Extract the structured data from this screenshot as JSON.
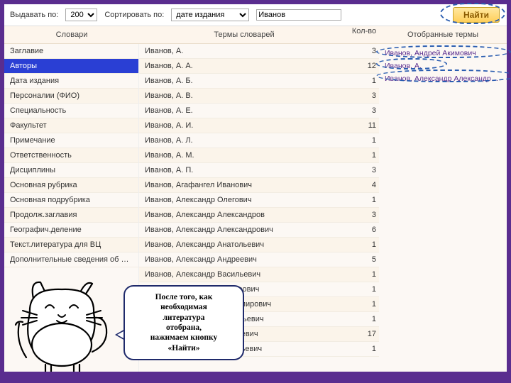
{
  "toolbar": {
    "perpage_label": "Выдавать по:",
    "perpage_value": "200",
    "sort_label": "Сортировать по:",
    "sort_value": "дате издания",
    "search_value": "Иванов",
    "find_label": "Найти"
  },
  "headers": {
    "dict": "Словари",
    "terms": "Термы словарей",
    "count": "Кол-во",
    "selected": "Отобранные термы"
  },
  "dictionaries": [
    "Заглавие",
    "Авторы",
    "Дата издания",
    "Персоналии (ФИО)",
    "Специальность",
    "Факультет",
    "Примечание",
    "Ответственность",
    "Дисциплины",
    "Основная рубрика",
    "Основная подрубрика",
    "Продолж.заглавия",
    "Географич.деление",
    "Текст.литература для ВЦ",
    "Дополнительные сведения об издании"
  ],
  "dict_selected_index": 1,
  "terms": [
    {
      "name": "Иванов, А.",
      "count": 3
    },
    {
      "name": "Иванов, А. А.",
      "count": 12
    },
    {
      "name": "Иванов, А. Б.",
      "count": 1
    },
    {
      "name": "Иванов, А. В.",
      "count": 3
    },
    {
      "name": "Иванов, А. Е.",
      "count": 3
    },
    {
      "name": "Иванов, А. И.",
      "count": 11
    },
    {
      "name": "Иванов, А. Л.",
      "count": 1
    },
    {
      "name": "Иванов, А. М.",
      "count": 1
    },
    {
      "name": "Иванов, А. П.",
      "count": 3
    },
    {
      "name": "Иванов, Агафангел Иванович",
      "count": 4
    },
    {
      "name": "Иванов, Александр Олегович",
      "count": 1
    },
    {
      "name": "Иванов, Александр Александров",
      "count": 3
    },
    {
      "name": "Иванов, Александр Александрович",
      "count": 6
    },
    {
      "name": "Иванов, Александр Анатольевич",
      "count": 1
    },
    {
      "name": "Иванов, Александр Андреевич",
      "count": 5
    },
    {
      "name": "Иванов, Александр Васильевич",
      "count": 1
    },
    {
      "name": "Иванов, Александр Викторович",
      "count": 1
    },
    {
      "name": "Иванов, Александр Владимирович",
      "count": 1
    },
    {
      "name": "Иванов, Александр Геннадьевич",
      "count": 1
    },
    {
      "name": "Иванов, Александр Георгиевич",
      "count": 17
    },
    {
      "name": "Иванов, Александр Григорьевич",
      "count": 1
    }
  ],
  "selected_terms": [
    "Иванов, Андрей Акимович",
    "Иванов, А.",
    "Иванов, Александр Александрович"
  ],
  "speech": {
    "l1": "После того, как",
    "l2": "необходимая",
    "l3": "литература",
    "l4": "отобрана,",
    "l5": "нажимаем кнопку",
    "l6": "«Найти»"
  }
}
